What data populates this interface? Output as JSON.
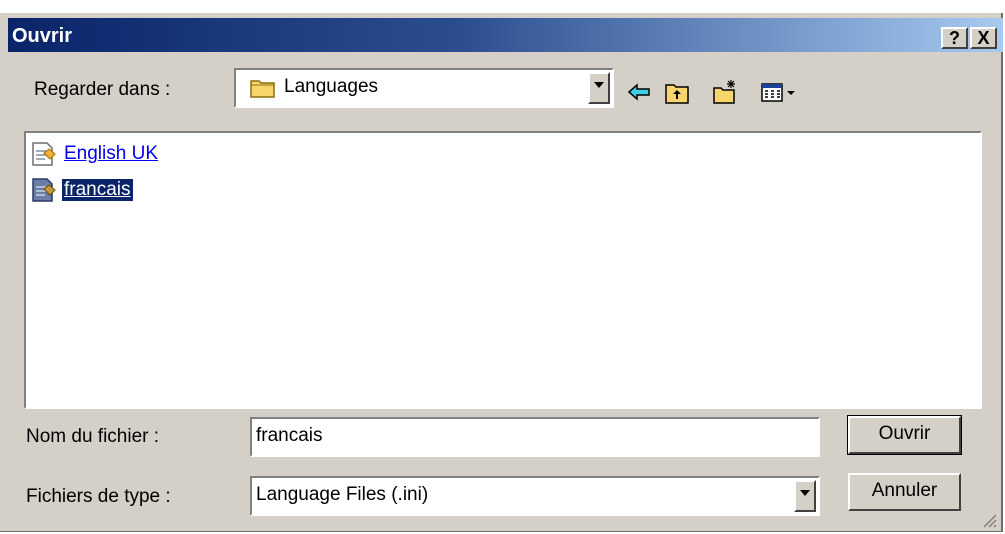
{
  "dialog": {
    "title": "Ouvrir",
    "help_btn": "?",
    "close_btn": "X"
  },
  "look_in": {
    "label": "Regarder dans :",
    "value": "Languages",
    "icon": "folder-icon"
  },
  "toolbar": {
    "icons": [
      "back-arrow-icon",
      "up-one-level-icon",
      "new-folder-icon",
      "view-menu-icon"
    ]
  },
  "files": [
    {
      "name": "English UK",
      "icon": "ini-file-icon",
      "selected": false
    },
    {
      "name": "francais",
      "icon": "ini-file-icon",
      "selected": true
    }
  ],
  "filename": {
    "label": "Nom du fichier :",
    "value": "francais"
  },
  "filetype": {
    "label": "Fichiers de type :",
    "value": "Language Files (.ini)"
  },
  "buttons": {
    "open": "Ouvrir",
    "cancel": "Annuler"
  },
  "colors": {
    "titlebar_start": "#0a246a",
    "titlebar_end": "#a6caf0",
    "dialog_face": "#d4d0c8",
    "selection": "#0a246a",
    "link": "#0000ee"
  }
}
